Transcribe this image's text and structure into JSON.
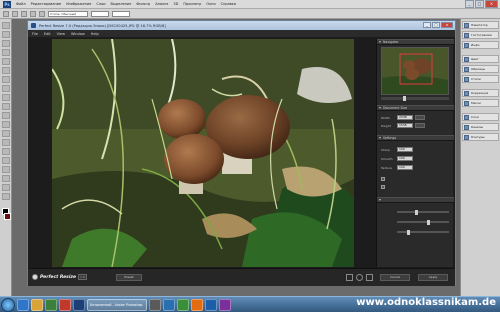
{
  "photoshop": {
    "logo": "Ps",
    "menu": [
      "Файл",
      "Редактирование",
      "Изображение",
      "Слои",
      "Выделение",
      "Фильтр",
      "Анализ",
      "3D",
      "Просмотр",
      "Окно",
      "Справка"
    ],
    "options_field": "Стиль: Обычный",
    "dock_items": [
      "Навигатор",
      "Гистограмма",
      "Инфо",
      "Цвет",
      "Образцы",
      "Стили",
      "Коррекция",
      "Маски",
      "Слои",
      "Каналы",
      "Контуры"
    ]
  },
  "perfect_resize": {
    "title": "Perfect Resize 7.0 (Редакция Эпохи) [DSC00425.JPG @ 16.7% RGB/8]",
    "menu": [
      "File",
      "Edit",
      "View",
      "Window",
      "Help"
    ],
    "panels": {
      "navigator": "Navigator",
      "document_size": "Document Size",
      "settings": "Settings"
    },
    "document_size_rows": [
      {
        "label": "Width",
        "value": "2048"
      },
      {
        "label": "Height",
        "value": "1536"
      }
    ],
    "settings_rows": [
      {
        "label": "Sharp.",
        "value": "100"
      },
      {
        "label": "Smooth",
        "value": "100"
      },
      {
        "label": "Texture",
        "value": "100"
      }
    ],
    "brand": "Perfect Resize",
    "version": "7.0",
    "buttons": {
      "cancel": "Cancel",
      "apply": "Apply",
      "preset": "Preset"
    }
  },
  "taskbar": {
    "active_task": "Безымянный - Adobe Photoshop"
  },
  "watermark": "www.odnoklassnikam.de"
}
